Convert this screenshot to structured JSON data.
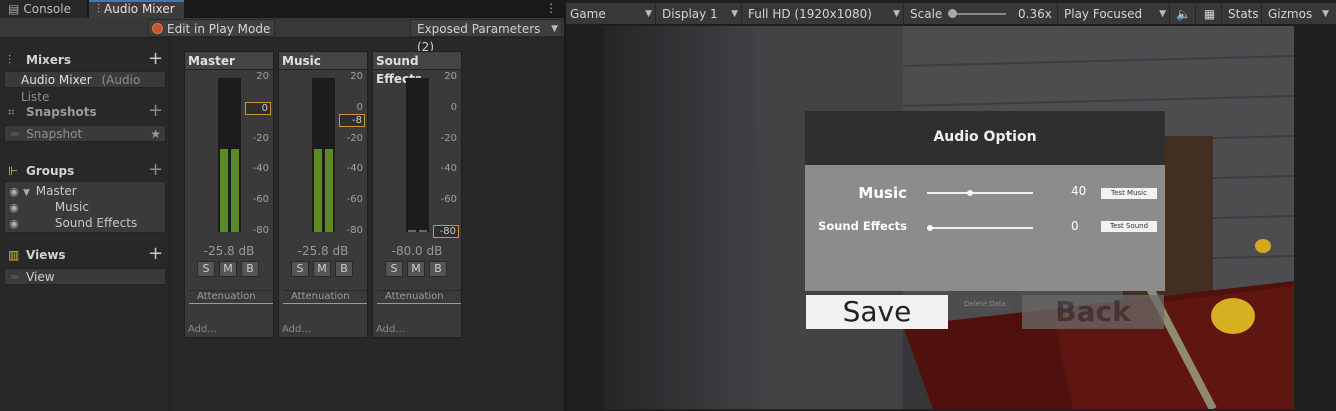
{
  "tabs": {
    "console": "Console",
    "audio_mixer": "Audio Mixer"
  },
  "mixer_toolbar": {
    "edit_in_play_mode": "Edit in Play Mode",
    "exposed_parameters": "Exposed Parameters (2)"
  },
  "sidebar": {
    "mixers_title": "Mixers",
    "mixer_item": "Audio Mixer",
    "mixer_item_hint": "(Audio Liste",
    "snapshots_title": "Snapshots",
    "snapshot_item": "Snapshot",
    "groups_title": "Groups",
    "groups": [
      "Master",
      "Music",
      "Sound Effects"
    ],
    "views_title": "Views",
    "view_item": "View"
  },
  "strips": [
    {
      "name": "Master",
      "db": "-25.8 dB",
      "fader_value": "0",
      "fader_db": 0,
      "meter_level_db": -25.8
    },
    {
      "name": "Music",
      "db": "-25.8 dB",
      "fader_value": "-8",
      "fader_db": -8,
      "meter_level_db": -25.8
    },
    {
      "name": "Sound Effects",
      "db": "-80.0 dB",
      "fader_value": "-80",
      "fader_db": -80,
      "meter_level_db": -80
    }
  ],
  "strip_common": {
    "s": "S",
    "m": "M",
    "b": "B",
    "attenuation": "Attenuation",
    "add": "Add..."
  },
  "meter_scale": [
    "20",
    "0",
    "-20",
    "-40",
    "-60",
    "-80"
  ],
  "game_toolbar": {
    "view": "Game",
    "display": "Display 1",
    "resolution": "Full HD (1920x1080)",
    "scale_label": "Scale",
    "scale_value": "0.36x",
    "play_focused": "Play Focused",
    "stats": "Stats",
    "gizmos": "Gizmos"
  },
  "game_ui": {
    "title": "Audio Option",
    "music_label": "Music",
    "music_value": "40",
    "music_slider_fraction": 0.4,
    "test_music": "Test Music",
    "sfx_label": "Sound Effects",
    "sfx_value": "0",
    "sfx_slider_fraction": 0,
    "test_sound": "Test Sound",
    "save": "Save",
    "delete_data": "Delete Data",
    "back": "Back"
  },
  "colors": {
    "accent_orange": "#c9962f",
    "meter_green": "#5a8a25",
    "record_dot": "#c9552e"
  }
}
